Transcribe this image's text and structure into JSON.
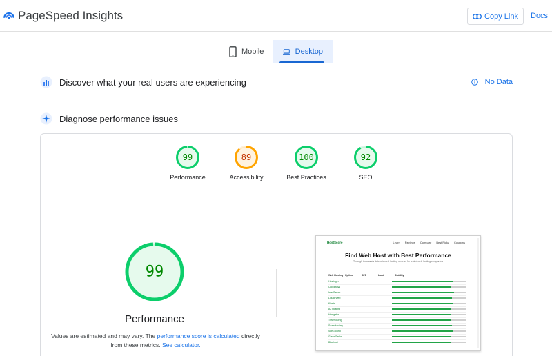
{
  "app": {
    "title": "PageSpeed Insights",
    "copy_link_label": "Copy Link",
    "docs_label": "Docs"
  },
  "tabs": [
    {
      "label": "Mobile",
      "selected": false
    },
    {
      "label": "Desktop",
      "selected": true
    }
  ],
  "discover": {
    "title": "Discover what your real users are experiencing",
    "no_data_label": "No Data"
  },
  "diagnose": {
    "title": "Diagnose performance issues"
  },
  "scores": [
    {
      "label": "Performance",
      "value": 99,
      "color": "#0cce6b"
    },
    {
      "label": "Accessibility",
      "value": 89,
      "color": "#ffa400"
    },
    {
      "label": "Best Practices",
      "value": 100,
      "color": "#0cce6b"
    },
    {
      "label": "SEO",
      "value": 92,
      "color": "#0cce6b"
    }
  ],
  "main_gauge": {
    "value": 99,
    "label": "Performance",
    "note_prefix": "Values are estimated and may vary. The ",
    "note_link1": "performance score is calculated",
    "note_middle": " directly from these metrics. ",
    "note_link2": "See calculator."
  },
  "colors": {
    "pass": "#0cce6b",
    "average": "#ffa400",
    "link": "#1a73e8"
  },
  "thumbnail": {
    "logo": "HostScore",
    "nav": [
      "Learn",
      "Reviews",
      "Compare",
      "Best Picks",
      "Coupons"
    ],
    "heading": "Find Web Host with Best Performance",
    "subheading": "Through thousands data-oriented hosting reviews for tested web hosting companies",
    "columns": [
      "Web Hosting",
      "Uptime",
      "SPD",
      "Load",
      "Stability"
    ],
    "rows": [
      {
        "name": "Hostinger",
        "fill": 0.82
      },
      {
        "name": "Cloudways",
        "fill": 0.8
      },
      {
        "name": "InterServer",
        "fill": 0.83
      },
      {
        "name": "Liquid Web",
        "fill": 0.81
      },
      {
        "name": "Kinsta",
        "fill": 0.82
      },
      {
        "name": "A2 Hosting",
        "fill": 0.8
      },
      {
        "name": "Hostgator",
        "fill": 0.79
      },
      {
        "name": "TMDHosting",
        "fill": 0.8
      },
      {
        "name": "ScalaHosting",
        "fill": 0.81
      },
      {
        "name": "SiteGround",
        "fill": 0.82
      },
      {
        "name": "GreenGeeks",
        "fill": 0.8
      },
      {
        "name": "Bluehost",
        "fill": 0.79
      }
    ]
  }
}
